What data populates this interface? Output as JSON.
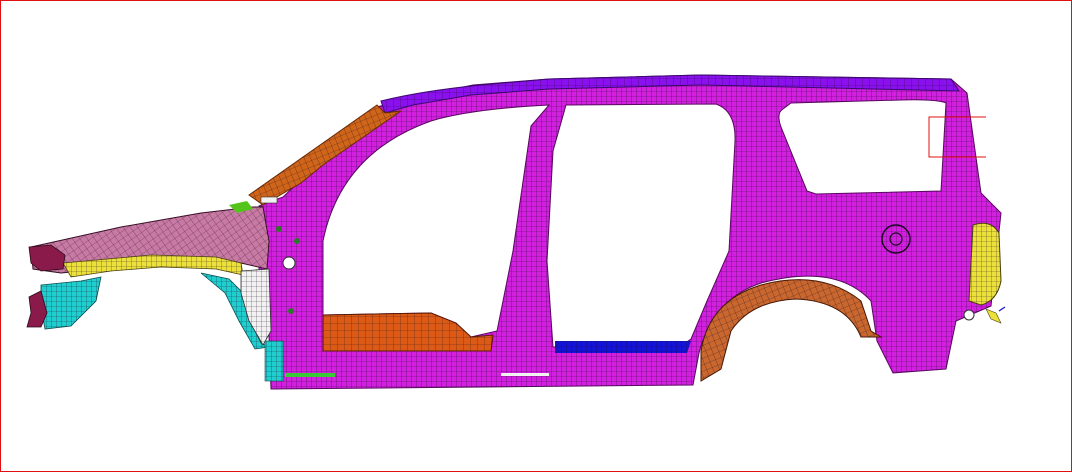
{
  "viewport": {
    "border_color": "#e01010",
    "background": "#ffffff"
  },
  "colors": {
    "body_side": "#d21fe0",
    "roof_rail": "#8a10ee",
    "a_pillar": "#d0651a",
    "sill": "#dc5a16",
    "wheelhouse_rear": "#c9672e",
    "rocker_blue": "#1414d8",
    "taillamp": "#ece03a",
    "fender_apron": "#c97aa4",
    "fender_yellow": "#ece03a",
    "fender_cyan": "#1fcfcf",
    "fender_white": "#f2f2f2",
    "front_tip": "#8a1a4a",
    "hinge_green": "#55c41a",
    "sill_green": "#38c838",
    "mesh_line": "#1a0a20",
    "selection_box": "#e01010"
  },
  "selection_box": {
    "visible": true
  }
}
